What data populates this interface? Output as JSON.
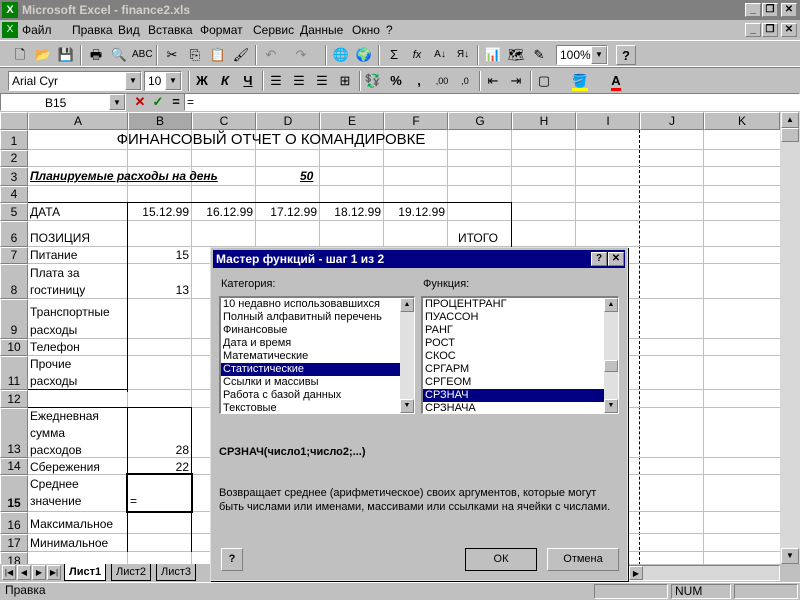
{
  "window": {
    "title": "Microsoft Excel - finance2.xls"
  },
  "menu": [
    "Файл",
    "Правка",
    "Вид",
    "Вставка",
    "Формат",
    "Сервис",
    "Данные",
    "Окно",
    "?"
  ],
  "toolbar": {
    "zoom": "100%",
    "font": "Arial Cyr",
    "font_size": "10",
    "bold_label": "Ж",
    "italic_label": "К",
    "underline_label": "Ч",
    "percent_label": "%",
    "comma_label": ",",
    "sum_label": "Σ",
    "fx_label": "fx"
  },
  "formula_bar": {
    "name_box": "B15",
    "equals": "=",
    "content": "="
  },
  "columns": [
    "A",
    "B",
    "C",
    "D",
    "E",
    "F",
    "G",
    "H",
    "I",
    "J",
    "K"
  ],
  "rows": [
    "1",
    "2",
    "3",
    "4",
    "5",
    "6",
    "7",
    "8",
    "9",
    "10",
    "11",
    "12",
    "13",
    "14",
    "15",
    "16",
    "17",
    "18"
  ],
  "cells": {
    "title": "ФИНАНСОВЫЙ ОТЧЕТ О КОМАНДИРОВКЕ",
    "planned_label": "Планируемые расходы на день",
    "planned_value": "50",
    "date_label": "ДАТА",
    "dates": [
      "15.12.99",
      "16.12.99",
      "17.12.99",
      "18.12.99",
      "19.12.99"
    ],
    "position_label": "ПОЗИЦИЯ",
    "total_label": "ИТОГО",
    "food_label": "Питание",
    "food_value": "15",
    "hotel_label_1": "Плата за",
    "hotel_label_2": "гостиницу",
    "hotel_value": "13",
    "transport_label_1": "Транспортные",
    "transport_label_2": "расходы",
    "phone_label": "Телефон",
    "other_label_1": "Прочие",
    "other_label_2": "расходы",
    "daily_label_1": "Ежедневная",
    "daily_label_2": "сумма",
    "daily_label_3": "расходов",
    "daily_value": "28",
    "savings_label": "Сбережения",
    "savings_value": "22",
    "avg_label_1": "Среднее",
    "avg_label_2": "значение",
    "avg_value": "=",
    "max_label": "Максимальное",
    "min_label": "Минимальное"
  },
  "sheet_tabs": [
    "Лист1",
    "Лист2",
    "Лист3"
  ],
  "status": {
    "mode": "Правка",
    "num": "NUM"
  },
  "dialog": {
    "title": "Мастер функций - шаг 1 из 2",
    "help_btn": "?",
    "close_btn": "✕",
    "category_label": "Категория:",
    "function_label": "Функция:",
    "categories": [
      "10 недавно использовавшихся",
      "Полный алфавитный перечень",
      "Финансовые",
      "Дата и время",
      "Математические",
      "Статистические",
      "Ссылки и массивы",
      "Работа с базой данных",
      "Текстовые"
    ],
    "selected_category": "Статистические",
    "functions": [
      "ПРОЦЕНТРАНГ",
      "ПУАССОН",
      "РАНГ",
      "РОСТ",
      "СКОС",
      "СРГАРМ",
      "СРГЕОМ",
      "СРЗНАЧ",
      "СРЗНАЧА"
    ],
    "selected_function": "СРЗНАЧ",
    "signature": "СРЗНАЧ(число1;число2;...)",
    "description": "Возвращает среднее (арифметическое) своих аргументов, которые могут быть числами или именами, массивами или ссылками на ячейки с числами.",
    "ok": "ОК",
    "cancel": "Отмена"
  }
}
